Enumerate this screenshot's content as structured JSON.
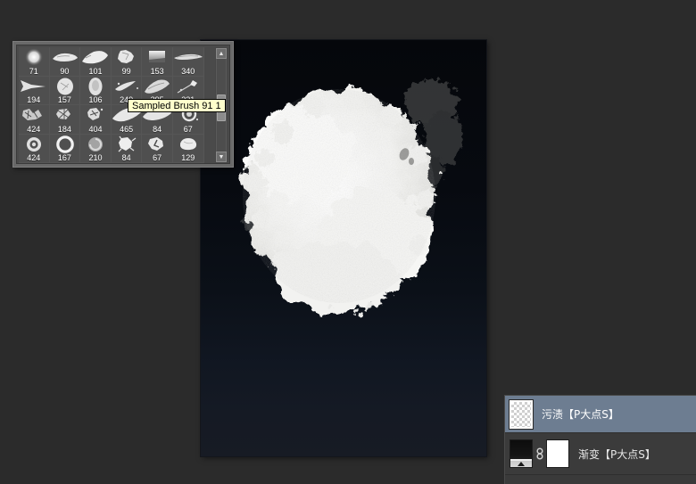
{
  "app": {
    "background_color": "#2b2b2b"
  },
  "canvas": {
    "name": "document-canvas",
    "background_color": "#0a0c11",
    "layers_visible": [
      "gradient",
      "stain"
    ]
  },
  "brush_panel": {
    "title": "brush-preset-picker",
    "tooltip": "Sampled Brush 91 1",
    "scrollbar": {
      "up_arrow": "▲",
      "down_arrow": "▼"
    },
    "rows": [
      {
        "cells": [
          {
            "size": "71",
            "shape": "soft-round"
          },
          {
            "size": "90",
            "shape": "flat-leaf"
          },
          {
            "size": "101",
            "shape": "pointed-leaf"
          },
          {
            "size": "99",
            "shape": "crumpled-blot"
          },
          {
            "size": "153",
            "shape": "square-smear"
          },
          {
            "size": "340",
            "shape": "long-streak"
          }
        ]
      },
      {
        "cells": [
          {
            "size": "194",
            "shape": "wedge-horn"
          },
          {
            "size": "157",
            "shape": "round-speckle"
          },
          {
            "size": "106",
            "shape": "oval-texture"
          },
          {
            "size": "249",
            "shape": "scatter-wing"
          },
          {
            "size": "295",
            "shape": "angled-leaf"
          },
          {
            "size": "231",
            "shape": "small-splatter"
          }
        ]
      },
      {
        "cells": [
          {
            "size": "424",
            "shape": "chaotic-spray"
          },
          {
            "size": "184",
            "shape": "burst-spray"
          },
          {
            "size": "404",
            "shape": "ink-splash"
          },
          {
            "size": "465",
            "shape": "long-blade"
          },
          {
            "size": "84",
            "shape": "wide-blade"
          },
          {
            "size": "67",
            "shape": "ring-splatter"
          }
        ]
      },
      {
        "cells": [
          {
            "size": "424",
            "shape": "donut-ring"
          },
          {
            "size": "167",
            "shape": "thick-ring"
          },
          {
            "size": "210",
            "shape": "soft-swirl"
          },
          {
            "size": "84",
            "shape": "fuzzy-blob"
          },
          {
            "size": "67",
            "shape": "torn-blob"
          },
          {
            "size": "129",
            "shape": "cloud-blob"
          }
        ]
      }
    ]
  },
  "layers_panel": {
    "name": "layers-panel",
    "selected_index": 0,
    "layers": [
      {
        "name": "污渍【P大点S】",
        "thumb_type": "transparent",
        "selected": true,
        "has_mask": false,
        "linked": false
      },
      {
        "name": "渐变【P大点S】",
        "thumb_type": "gradient",
        "selected": false,
        "has_mask": true,
        "linked": true
      }
    ]
  }
}
